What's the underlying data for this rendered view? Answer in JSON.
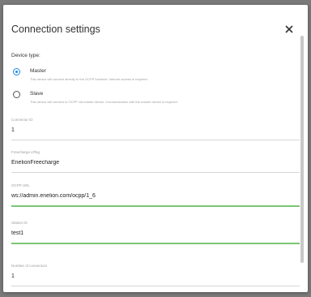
{
  "dialog": {
    "title": "Connection settings",
    "close_icon": "close-icon"
  },
  "device_type": {
    "label": "Device type:",
    "options": [
      {
        "label": "Master",
        "description": "This device will connect directly to the OCPP backend. Internet access is required.",
        "checked": true
      },
      {
        "label": "Slave",
        "description": "This device will connect to OCPP via master device. Communication with the master device is required.",
        "checked": false
      }
    ]
  },
  "fields": {
    "connector_id": {
      "label": "Connector ID",
      "value": "1"
    },
    "freecharge_rfid": {
      "label": "Freecharge idTag",
      "value": "EnelionFreecharge"
    },
    "ocpp_url": {
      "label": "OCPP URL",
      "value": "ws://admin.enelion.com/ocpp/1_6"
    },
    "station_id": {
      "label": "Station ID",
      "value": "test1"
    },
    "num_connectors": {
      "label": "Number of connectors",
      "value": "1"
    }
  },
  "colors": {
    "accent": "#1e88e5",
    "active_underline": "#7cc576",
    "backdrop": "#7a7a7a"
  }
}
